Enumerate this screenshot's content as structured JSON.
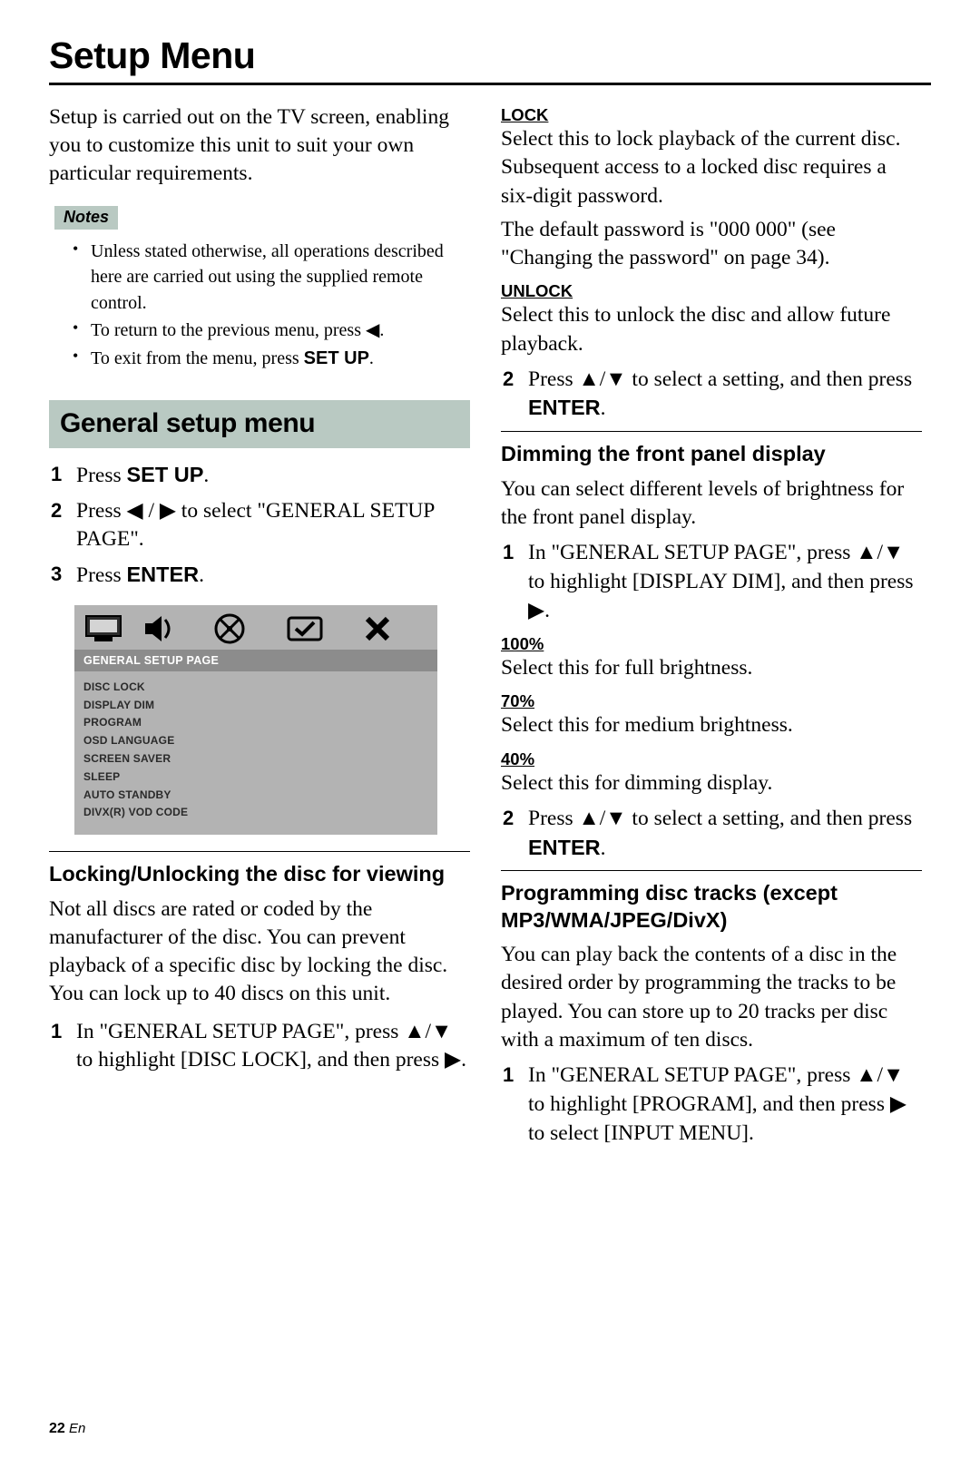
{
  "page_title": "Setup Menu",
  "intro": "Setup is carried out on the TV screen, enabling you to customize this unit to suit your own particular requirements.",
  "notes_label": "Notes",
  "notes": [
    "Unless stated otherwise, all operations described here are carried out using the supplied remote control.",
    "To return to the previous menu, press ◀.",
    "To exit from the menu, press "
  ],
  "notes_setup_bold": "SET UP",
  "notes_tail": ".",
  "section_general": "General setup menu",
  "steps_general": {
    "s1a": "Press ",
    "s1b": "SET UP",
    "s1c": ".",
    "s2": "Press ◀ / ▶ to select \"GENERAL SETUP PAGE\".",
    "s3a": "Press ",
    "s3b": "ENTER",
    "s3c": "."
  },
  "osd": {
    "header": "GENERAL SETUP PAGE",
    "items": [
      "DISC LOCK",
      "DISPLAY DIM",
      "PROGRAM",
      "OSD LANGUAGE",
      "SCREEN SAVER",
      "SLEEP",
      "AUTO STANDBY",
      "DIVX(R) VOD CODE"
    ]
  },
  "sub_lock_title": "Locking/Unlocking the disc for viewing",
  "sub_lock_para": "Not all discs are rated or coded by the manufacturer of the disc. You can prevent playback of a specific disc by locking the disc. You can lock up to 40 discs on this unit.",
  "lock_step1": "In \"GENERAL SETUP PAGE\", press ▲/▼ to highlight [DISC LOCK], and then press ▶.",
  "opt_lock": "LOCK",
  "opt_lock_text": "Select this to lock playback of the current disc. Subsequent access to a locked disc requires a six-digit password.",
  "opt_lock_text2": "The default password is \"000 000\" (see \"Changing the password\" on page 34).",
  "opt_unlock": "UNLOCK",
  "opt_unlock_text": "Select this to unlock the disc and allow future playback.",
  "lock_step2a": "Press ▲/▼ to select a setting, and then press ",
  "lock_step2b": "ENTER",
  "lock_step2c": ".",
  "sub_dim_title": "Dimming the front panel display",
  "sub_dim_para": "You can select different levels of brightness for the front panel display.",
  "dim_step1": "In \"GENERAL SETUP PAGE\", press ▲/▼ to highlight [DISPLAY DIM], and then press ▶.",
  "dim_opts": [
    {
      "k": "100%",
      "v": "Select this for full brightness."
    },
    {
      "k": "70%",
      "v": "Select this for medium brightness."
    },
    {
      "k": "40%",
      "v": "Select this for dimming display."
    }
  ],
  "dim_step2a": "Press ▲/▼ to select a setting, and then press ",
  "dim_step2b": "ENTER",
  "dim_step2c": ".",
  "sub_prog_title": "Programming disc tracks (except MP3/WMA/JPEG/DivX)",
  "sub_prog_para": "You can play back the contents of a disc in the desired order by programming the tracks to be played. You can store up to 20 tracks per disc with a maximum of ten discs.",
  "prog_step1": "In \"GENERAL SETUP PAGE\", press ▲/▼ to highlight [PROGRAM], and then press ▶ to select [INPUT MENU].",
  "footer_page": "22",
  "footer_lang": "En"
}
